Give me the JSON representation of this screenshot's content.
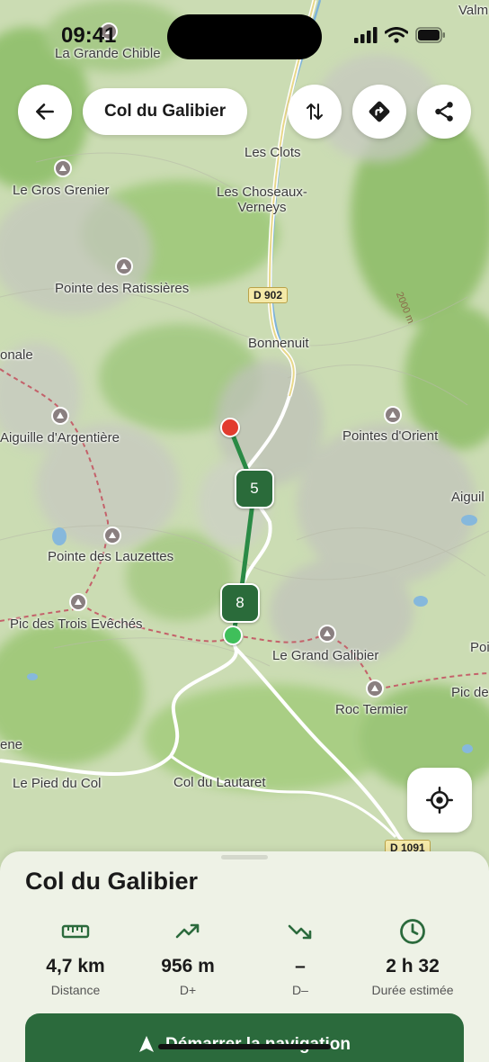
{
  "status": {
    "time": "09:41"
  },
  "header": {
    "title": "Col du Galibier"
  },
  "icons": {
    "back": "arrow-left-icon",
    "swap": "swap-vertical-icon",
    "directions": "directions-icon",
    "share": "share-icon",
    "locate": "locate-crosshair-icon"
  },
  "map": {
    "places": [
      {
        "key": "valm",
        "label": "Valm"
      },
      {
        "key": "grande_chible",
        "label": "La Grande Chible"
      },
      {
        "key": "les_clots",
        "label": "Les Clots"
      },
      {
        "key": "gros_grenier",
        "label": "Le Gros Grenier"
      },
      {
        "key": "choseaux",
        "label": "Les Choseaux-\nVerneys"
      },
      {
        "key": "ratissieres",
        "label": "Pointe des Ratissières"
      },
      {
        "key": "bonnenuit",
        "label": "Bonnenuit"
      },
      {
        "key": "onale",
        "label": "onale"
      },
      {
        "key": "argentiere",
        "label": "Aiguille d'Argentière"
      },
      {
        "key": "orient",
        "label": "Pointes d'Orient"
      },
      {
        "key": "aiguil",
        "label": "Aiguil"
      },
      {
        "key": "lauzettes",
        "label": "Pointe des Lauzettes"
      },
      {
        "key": "trois_eveches",
        "label": "Pic des Trois Evêchés"
      },
      {
        "key": "grand_galibier",
        "label": "Le Grand Galibier"
      },
      {
        "key": "poi",
        "label": "Poi"
      },
      {
        "key": "roc_termier",
        "label": "Roc Termier"
      },
      {
        "key": "pic_de",
        "label": "Pic de"
      },
      {
        "key": "ene",
        "label": "ene"
      },
      {
        "key": "pied_du_col",
        "label": "Le Pied du Col"
      },
      {
        "key": "lautaret",
        "label": "Col du Lautaret"
      }
    ],
    "roads": {
      "d902": "D 902",
      "d1091": "D 1091"
    },
    "contour": "2000 m",
    "waypoints": {
      "first": "5",
      "second": "8"
    },
    "colors": {
      "route": "#2a8a45",
      "start": "#3fbf5a",
      "end": "#e23b2e",
      "trail": "#c9686a",
      "water": "#7fb3d8"
    }
  },
  "route": {
    "title": "Col du Galibier",
    "stats": [
      {
        "icon": "ruler-icon",
        "value": "4,7 km",
        "label": "Distance"
      },
      {
        "icon": "trend-up-icon",
        "value": "956 m",
        "label": "D+"
      },
      {
        "icon": "trend-down-icon",
        "value": "–",
        "label": "D–"
      },
      {
        "icon": "clock-icon",
        "value": "2 h 32",
        "label": "Durée estimée"
      }
    ],
    "cta": "Démarrer la navigation"
  }
}
